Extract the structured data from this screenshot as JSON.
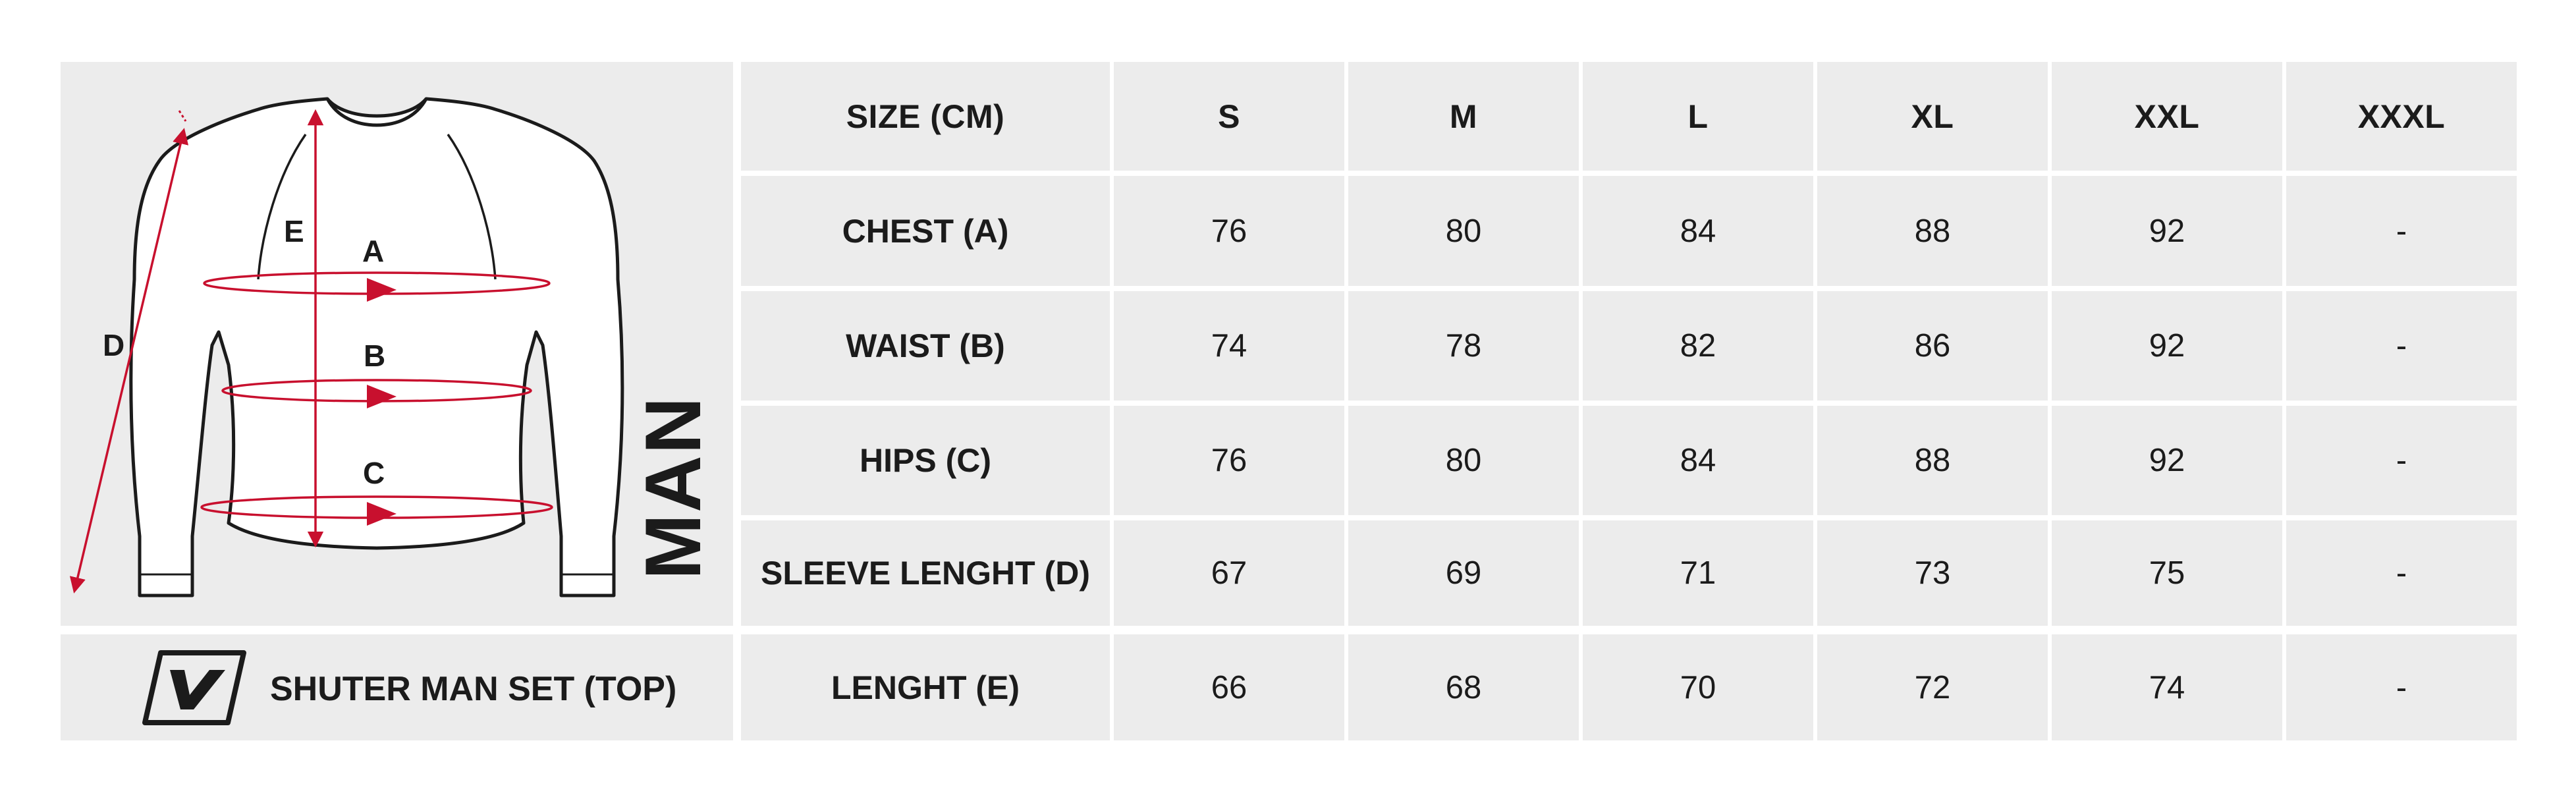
{
  "product": {
    "name": "SHUTER MAN SET (TOP)",
    "gender": "MAN"
  },
  "figure": {
    "labels": {
      "a": "A",
      "b": "B",
      "c": "C",
      "d": "D",
      "e": "E"
    },
    "accent_color": "#c8102e"
  },
  "table": {
    "header_label": "SIZE (CM)",
    "sizes": [
      "S",
      "M",
      "L",
      "XL",
      "XXL",
      "XXXL"
    ],
    "rows": [
      {
        "label": "CHEST (A)",
        "values": [
          "76",
          "80",
          "84",
          "88",
          "92",
          "-"
        ]
      },
      {
        "label": "WAIST (B)",
        "values": [
          "74",
          "78",
          "82",
          "86",
          "92",
          "-"
        ]
      },
      {
        "label": "HIPS (C)",
        "values": [
          "76",
          "80",
          "84",
          "88",
          "92",
          "-"
        ]
      },
      {
        "label": "SLEEVE LENGHT (D)",
        "values": [
          "67",
          "69",
          "71",
          "73",
          "75",
          "-"
        ]
      },
      {
        "label": "LENGHT (E)",
        "values": [
          "66",
          "68",
          "70",
          "72",
          "74",
          "-"
        ]
      }
    ]
  }
}
